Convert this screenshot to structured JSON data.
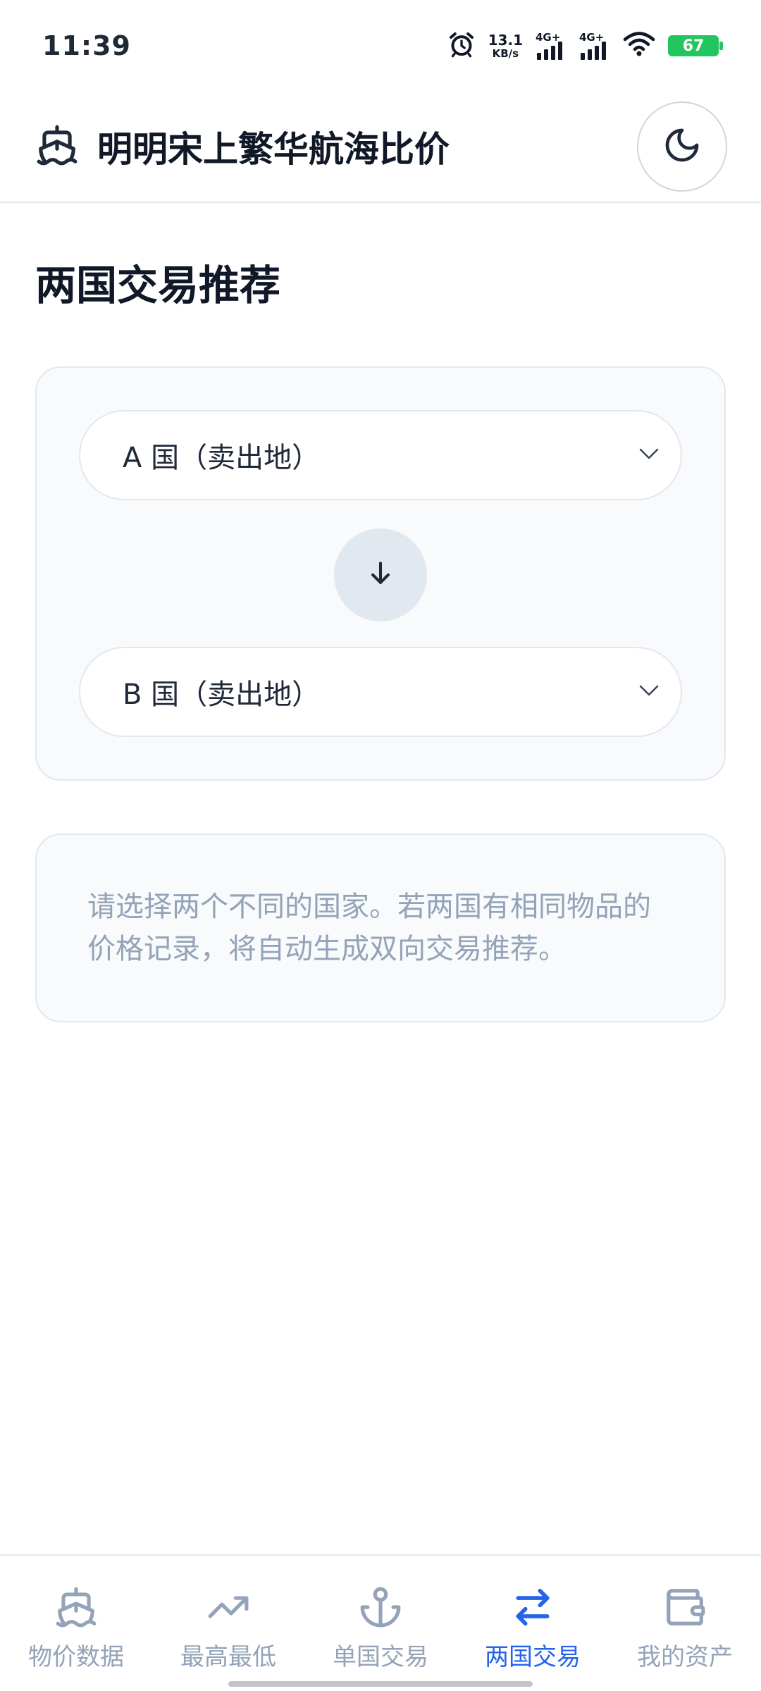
{
  "status_bar": {
    "time": "11:39",
    "net_speed_value": "13.1",
    "net_speed_unit": "KB/s",
    "signal1_label": "4G+",
    "signal2_label": "4G+",
    "battery": "67"
  },
  "header": {
    "title": "明明宋上繁华航海比价",
    "logo_icon": "ship-icon",
    "theme_icon": "moon-icon"
  },
  "main": {
    "section_title": "两国交易推荐",
    "country_a_select": "A 国（卖出地）",
    "country_b_select": "B 国（卖出地）",
    "swap_icon": "arrow-down-icon",
    "hint": "请选择两个不同的国家。若两国有相同物品的价格记录，将自动生成双向交易推荐。"
  },
  "bottom_nav": {
    "items": [
      {
        "label": "物价数据",
        "icon": "ship-icon",
        "active": false
      },
      {
        "label": "最高最低",
        "icon": "trending-up-icon",
        "active": false
      },
      {
        "label": "单国交易",
        "icon": "anchor-icon",
        "active": false
      },
      {
        "label": "两国交易",
        "icon": "swap-arrows-icon",
        "active": true
      },
      {
        "label": "我的资产",
        "icon": "wallet-icon",
        "active": false
      }
    ]
  },
  "colors": {
    "accent": "#2563eb",
    "inactive": "#94a3b8",
    "battery": "#22c55e"
  }
}
